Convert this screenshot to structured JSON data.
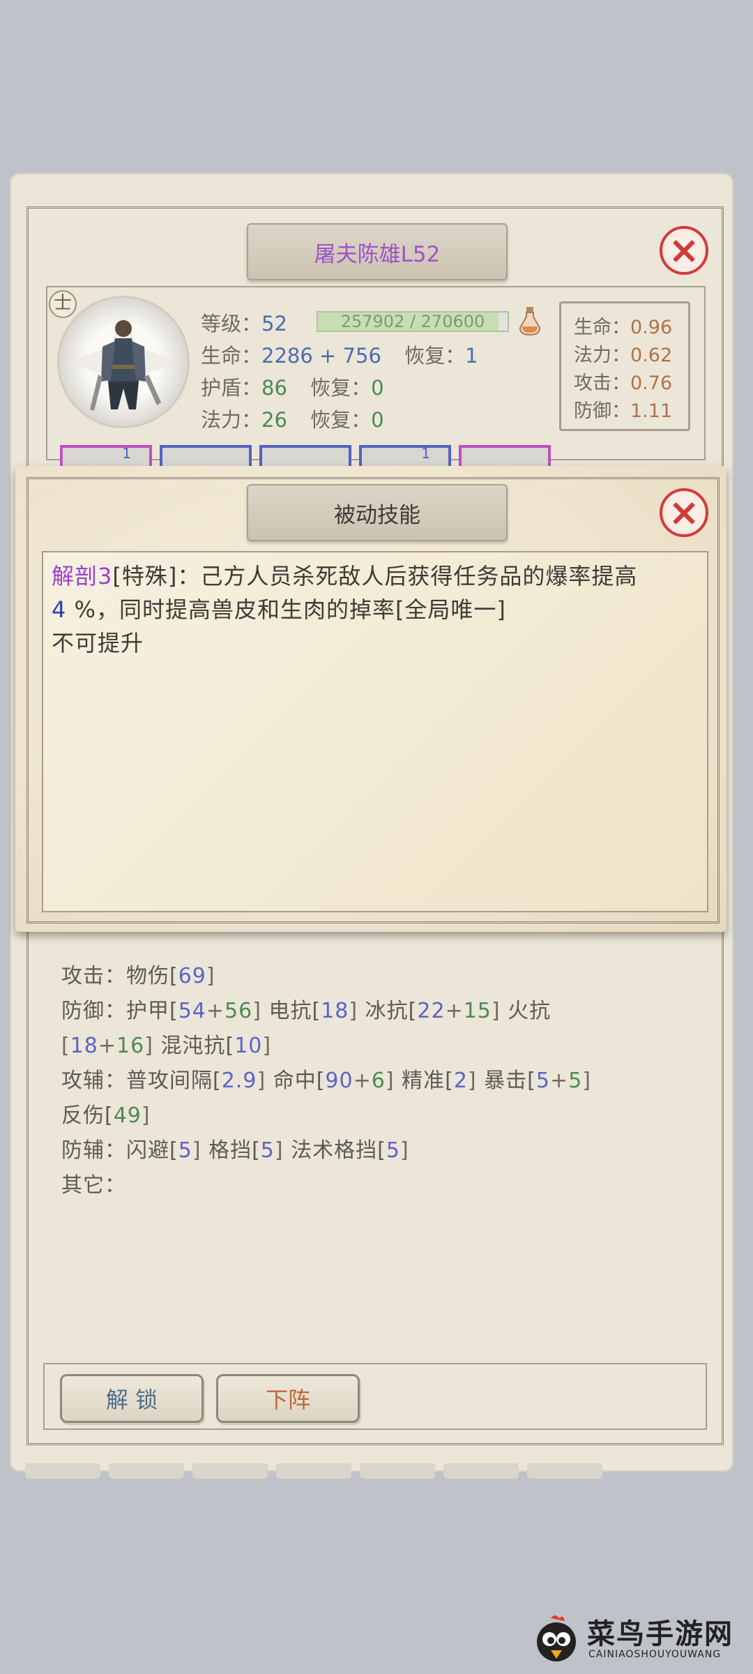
{
  "character": {
    "title": "屠夫陈雄L52",
    "rank_glyph": "士",
    "level_label": "等级：",
    "level": "52",
    "exp_text": "257902 / 270600",
    "exp_fraction": 0.953,
    "hp_label": "生命：",
    "hp_value": "2286 + 756",
    "hp_regen_label": "恢复：",
    "hp_regen": "1",
    "shield_label": "护盾：",
    "shield_value": "86",
    "shield_regen_label": "恢复：",
    "shield_regen": "0",
    "mp_label": "法力：",
    "mp_value": "26",
    "mp_regen_label": "恢复：",
    "mp_regen": "0"
  },
  "growth": [
    {
      "label": "生命：",
      "value": "0.96"
    },
    {
      "label": "法力：",
      "value": "0.62"
    },
    {
      "label": "攻击：",
      "value": "0.76"
    },
    {
      "label": "防御：",
      "value": "1.11"
    }
  ],
  "gear_slot_marks": [
    "1",
    "1"
  ],
  "popup": {
    "title": "被动技能",
    "skill_name": "解剖3",
    "skill_tag": "[特殊]：",
    "line1_text": "己方人员杀死敌人后获得任务品的爆率提高",
    "line2_value": "4",
    "line2_text": "%，同时提高兽皮和生肉的掉率[全局唯一]",
    "line3_text": "不可提升"
  },
  "details": {
    "attack_label": "攻击：",
    "attack_text": "物伤[",
    "attack_value": "69",
    "defense_label": "防御：",
    "armor_text": "护甲[",
    "armor_base": "54",
    "armor_bonus": "56",
    "elec_text": "电抗[",
    "elec_value": "18",
    "ice_text": "冰抗[",
    "ice_base": "22",
    "ice_bonus": "15",
    "fire_text": "火抗",
    "fire_base": "18",
    "fire_bonus": "16",
    "chaos_text": "混沌抗[",
    "chaos_value": "10",
    "offense_label": "攻辅：",
    "interval_text": "普攻间隔[",
    "interval_value": "2.9",
    "hit_text": "命中[",
    "hit_base": "90",
    "hit_bonus": "6",
    "precision_text": "精准[",
    "precision_value": "2",
    "crit_text": "暴击[",
    "crit_base": "5",
    "crit_bonus": "5",
    "reflect_text": "反伤[",
    "reflect_value": "49",
    "support_label": "防辅：",
    "dodge_text": "闪避[",
    "dodge_value": "5",
    "block_text": "格挡[",
    "block_value": "5",
    "spell_block_text": "法术格挡[",
    "spell_block_value": "5",
    "other_label": "其它："
  },
  "buttons": {
    "unlock": "解 锁",
    "retreat": "下阵"
  },
  "watermark": {
    "title": "菜鸟手游网",
    "subtitle": "CAINIAOSHOUYOUWANG"
  },
  "colors": {
    "title_purple": "#a053c9",
    "skill_purple": "#9b3fd6",
    "value_blue": "#4a6db0",
    "value_green": "#4a8a55",
    "close_red": "#d33a3a",
    "retreat_text": "#c0673a",
    "unlock_text": "#4f6f8a"
  }
}
